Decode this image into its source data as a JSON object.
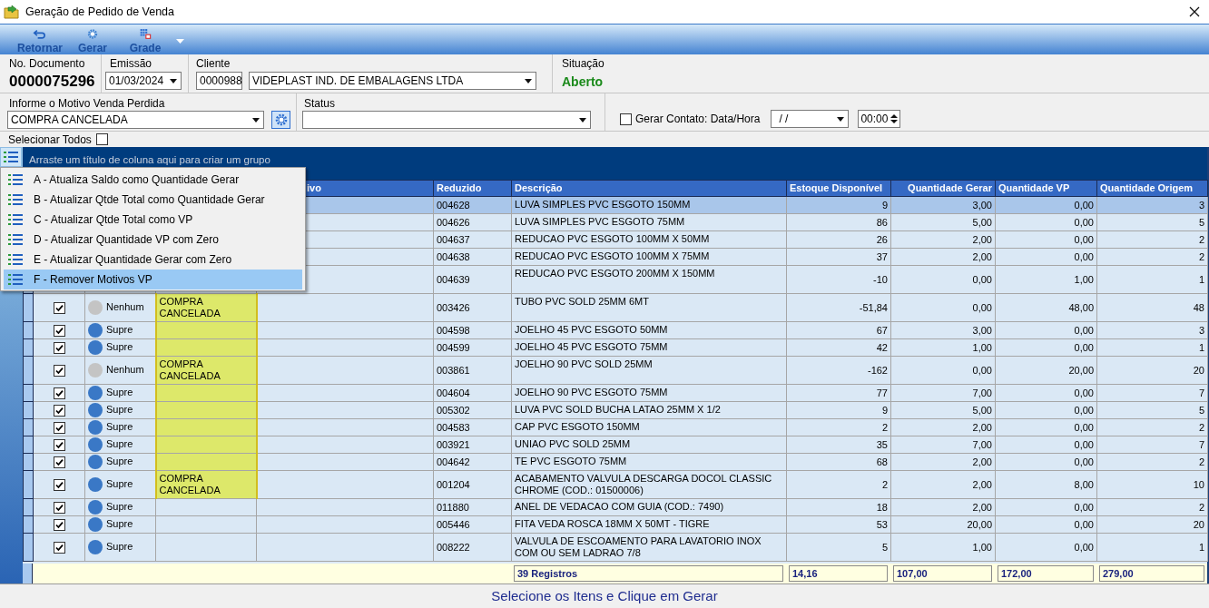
{
  "window": {
    "title": "Geração de Pedido de Venda"
  },
  "toolbar": {
    "buttons": [
      {
        "label": "Retornar",
        "kind": "undo"
      },
      {
        "label": "Gerar",
        "kind": "gear"
      },
      {
        "label": "Grade",
        "kind": "grid"
      }
    ]
  },
  "header": {
    "document": {
      "label": "No. Documento",
      "value": "0000075296"
    },
    "issue_date": {
      "label": "Emissão",
      "value": "01/03/2024"
    },
    "client": {
      "label": "Cliente",
      "code": "0000988",
      "name": "VIDEPLAST IND. DE EMBALAGENS LTDA"
    },
    "situation": {
      "label": "Situação",
      "value": "Aberto"
    },
    "lost_sale_reason": {
      "label": "Informe o Motivo Venda Perdida",
      "value": "COMPRA CANCELADA"
    },
    "status": {
      "label": "Status"
    },
    "contact": {
      "label": "Gerar Contato: Data/Hora",
      "checked": false,
      "date": "/ /",
      "time": "00:00"
    }
  },
  "select_all": {
    "label": "Selecionar Todos",
    "checked": false
  },
  "group_panel": {
    "hint": "Arraste um título de coluna aqui para criar um grupo"
  },
  "context_menu": {
    "items": [
      {
        "label": "A - Atualiza Saldo como Quantidade Gerar",
        "selected": false
      },
      {
        "label": "B - Atualizar Qtde Total como Quantidade Gerar",
        "selected": false
      },
      {
        "label": "C - Atualizar Qtde Total como VP",
        "selected": false
      },
      {
        "label": "D - Atualizar Quantidade VP com Zero",
        "selected": false
      },
      {
        "label": "E - Atualizar Quantidade Gerar com Zero",
        "selected": false
      },
      {
        "label": "F - Remover Motivos VP",
        "selected": true
      }
    ]
  },
  "table": {
    "columns": [
      {
        "label": "ivo"
      },
      {
        "label": "Reduzido"
      },
      {
        "label": "Descrição"
      },
      {
        "label": "Estoque Disponível"
      },
      {
        "label": "Quantidade Gerar"
      },
      {
        "label": "Quantidade VP"
      },
      {
        "label": "Quantidade Origem"
      }
    ],
    "rows": [
      {
        "selected": true,
        "tall": false,
        "reduzido": "004628",
        "descricao": "LUVA SIMPLES PVC ESGOTO 150MM",
        "estoque_disponivel": "9",
        "quantidade_gerar": "3,00",
        "quantidade_vp": "0,00",
        "quantidade_origem": "3"
      },
      {
        "selected": false,
        "tall": false,
        "reduzido": "004626",
        "descricao": "LUVA SIMPLES PVC ESGOTO 75MM",
        "estoque_disponivel": "86",
        "quantidade_gerar": "5,00",
        "quantidade_vp": "0,00",
        "quantidade_origem": "5"
      },
      {
        "selected": false,
        "tall": false,
        "reduzido": "004637",
        "descricao": "REDUCAO PVC ESGOTO 100MM X 50MM",
        "estoque_disponivel": "26",
        "quantidade_gerar": "2,00",
        "quantidade_vp": "0,00",
        "quantidade_origem": "2"
      },
      {
        "selected": false,
        "tall": false,
        "reduzido": "004638",
        "descricao": "REDUCAO PVC ESGOTO 100MM X 75MM",
        "estoque_disponivel": "37",
        "quantidade_gerar": "2,00",
        "quantidade_vp": "0,00",
        "quantidade_origem": "2"
      },
      {
        "selected": false,
        "tall": true,
        "reduzido": "004639",
        "descricao": "REDUCAO PVC ESGOTO 200MM X 150MM",
        "estoque_disponivel": "-10",
        "quantidade_gerar": "0,00",
        "quantidade_vp": "1,00",
        "quantidade_origem": "1"
      },
      {
        "selected": false,
        "tall": true,
        "checked": true,
        "column_3": {
          "text": "Nenhum",
          "color": "#c4c4c4"
        },
        "column_4": "COMPRA CANCELADA",
        "highlighted": true,
        "reduzido": "003426",
        "descricao": "TUBO PVC SOLD 25MM 6MT",
        "estoque_disponivel": "-51,84",
        "quantidade_gerar": "0,00",
        "quantidade_vp": "48,00",
        "quantidade_origem": "48"
      },
      {
        "selected": false,
        "tall": false,
        "checked": true,
        "column_3": {
          "text": "Supre",
          "color": "#3a78c6"
        },
        "highlighted": true,
        "reduzido": "004598",
        "descricao": "JOELHO 45 PVC ESGOTO 50MM",
        "estoque_disponivel": "67",
        "quantidade_gerar": "3,00",
        "quantidade_vp": "0,00",
        "quantidade_origem": "3"
      },
      {
        "selected": false,
        "tall": false,
        "checked": true,
        "column_3": {
          "text": "Supre",
          "color": "#3a78c6"
        },
        "highlighted": true,
        "reduzido": "004599",
        "descricao": "JOELHO 45 PVC ESGOTO 75MM",
        "estoque_disponivel": "42",
        "quantidade_gerar": "1,00",
        "quantidade_vp": "0,00",
        "quantidade_origem": "1"
      },
      {
        "selected": false,
        "tall": true,
        "checked": true,
        "column_3": {
          "text": "Nenhum",
          "color": "#c4c4c4"
        },
        "column_4": "COMPRA CANCELADA",
        "highlighted": true,
        "reduzido": "003861",
        "descricao": "JOELHO 90 PVC SOLD 25MM",
        "estoque_disponivel": "-162",
        "quantidade_gerar": "0,00",
        "quantidade_vp": "20,00",
        "quantidade_origem": "20"
      },
      {
        "selected": false,
        "tall": false,
        "checked": true,
        "column_3": {
          "text": "Supre",
          "color": "#3a78c6"
        },
        "highlighted": true,
        "reduzido": "004604",
        "descricao": "JOELHO 90 PVC ESGOTO 75MM",
        "estoque_disponivel": "77",
        "quantidade_gerar": "7,00",
        "quantidade_vp": "0,00",
        "quantidade_origem": "7"
      },
      {
        "selected": false,
        "tall": false,
        "checked": true,
        "column_3": {
          "text": "Supre",
          "color": "#3a78c6"
        },
        "highlighted": true,
        "reduzido": "005302",
        "descricao": "LUVA PVC SOLD BUCHA LATAO 25MM X 1/2",
        "estoque_disponivel": "9",
        "quantidade_gerar": "5,00",
        "quantidade_vp": "0,00",
        "quantidade_origem": "5"
      },
      {
        "selected": false,
        "tall": false,
        "checked": true,
        "column_3": {
          "text": "Supre",
          "color": "#3a78c6"
        },
        "highlighted": true,
        "reduzido": "004583",
        "descricao": "CAP PVC ESGOTO 150MM",
        "estoque_disponivel": "2",
        "quantidade_gerar": "2,00",
        "quantidade_vp": "0,00",
        "quantidade_origem": "2"
      },
      {
        "selected": false,
        "tall": false,
        "checked": true,
        "column_3": {
          "text": "Supre",
          "color": "#3a78c6"
        },
        "highlighted": true,
        "reduzido": "003921",
        "descricao": "UNIAO PVC SOLD 25MM",
        "estoque_disponivel": "35",
        "quantidade_gerar": "7,00",
        "quantidade_vp": "0,00",
        "quantidade_origem": "7"
      },
      {
        "selected": false,
        "tall": false,
        "checked": true,
        "column_3": {
          "text": "Supre",
          "color": "#3a78c6"
        },
        "highlighted": true,
        "reduzido": "004642",
        "descricao": "TE PVC ESGOTO 75MM",
        "estoque_disponivel": "68",
        "quantidade_gerar": "2,00",
        "quantidade_vp": "0,00",
        "quantidade_origem": "2"
      },
      {
        "selected": false,
        "tall": true,
        "checked": true,
        "column_3": {
          "text": "Supre",
          "color": "#3a78c6"
        },
        "column_4": "COMPRA CANCELADA",
        "highlighted": true,
        "reduzido": "001204",
        "descricao": "ACABAMENTO VALVULA DESCARGA DOCOL CLASSIC CHROME (COD.: 01500006)",
        "estoque_disponivel": "2",
        "quantidade_gerar": "2,00",
        "quantidade_vp": "8,00",
        "quantidade_origem": "10"
      },
      {
        "selected": false,
        "tall": false,
        "checked": true,
        "column_3": {
          "text": "Supre",
          "color": "#3a78c6"
        },
        "highlighted": false,
        "reduzido": "011880",
        "descricao": "ANEL DE VEDACAO COM GUIA (COD.: 7490)",
        "estoque_disponivel": "18",
        "quantidade_gerar": "2,00",
        "quantidade_vp": "0,00",
        "quantidade_origem": "2"
      },
      {
        "selected": false,
        "tall": false,
        "checked": true,
        "column_3": {
          "text": "Supre",
          "color": "#3a78c6"
        },
        "highlighted": false,
        "reduzido": "005446",
        "descricao": "FITA VEDA ROSCA 18MM X 50MT - TIGRE",
        "estoque_disponivel": "53",
        "quantidade_gerar": "20,00",
        "quantidade_vp": "0,00",
        "quantidade_origem": "20"
      },
      {
        "selected": false,
        "tall": true,
        "checked": true,
        "column_3": {
          "text": "Supre",
          "color": "#3a78c6"
        },
        "highlighted": false,
        "reduzido": "008222",
        "descricao": "VALVULA DE ESCOAMENTO PARA LAVATORIO INOX COM OU SEM LADRAO 7/8",
        "estoque_disponivel": "5",
        "quantidade_gerar": "1,00",
        "quantidade_vp": "0,00",
        "quantidade_origem": "1"
      }
    ]
  },
  "footer": {
    "count": "39 Registros",
    "totals": [
      "14,16",
      "107,00",
      "172,00",
      "279,00"
    ]
  },
  "status_bar": "Selecione os Itens e Clique em Gerar"
}
